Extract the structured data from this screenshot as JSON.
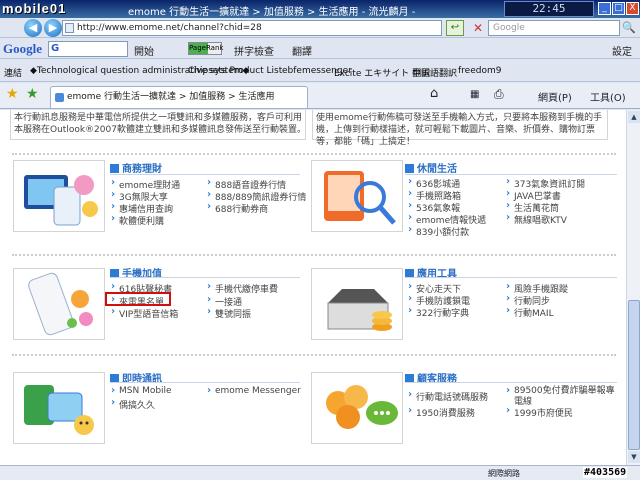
{
  "titlebar": {
    "logo": "mobile01",
    "title": "emome 行動生活一擴就達 > 加值服務 > 生活應用 - 流光麟月 -",
    "clock": "22:45",
    "minimize": "_",
    "maximize": "□",
    "close": "X"
  },
  "addressbar": {
    "back": "◀",
    "forward": "▶",
    "url": "http://www.emome.net/channel?chid=28",
    "go": "↩",
    "stop": "✕",
    "search_placeholder": "Google",
    "search_go": "🔍"
  },
  "googlebar": {
    "logo": "Google",
    "search_prefix": "G",
    "open_label": "開始",
    "pagerank_label": "PageRank",
    "spellcheck_label": "拼字檢查",
    "translate_label": "翻譯",
    "settings_label": "設定"
  },
  "linksbar": {
    "label": "連結",
    "items": [
      "◆Technological question administrative system◆",
      "Chipsets Product List",
      "ebfemessenger",
      "Excite エキサイト 翻訳",
      "中国語翻訳",
      "freedom9"
    ]
  },
  "tabbar": {
    "active_tab": "emome 行動生活一擴就達 > 加值服務 > 生活應用",
    "home": "⌂",
    "feeds": "▦",
    "print": "⎙",
    "page_label": "網頁(P)",
    "tools_label": "工具(O)"
  },
  "content": {
    "intro_left": "本行動訊息服務是中華電信所提供之一項雙訊和多媒體服務，客戶可利用本服務在Outlook®2007軟體建立雙訊和多媒體訊息發佈送至行動裝置。",
    "intro_right": "使用emome行動佈稿可發送至手機輸入方式，只要將本服務到手機的手機，上傳到行動樣描述，就可輕鬆下載圖片、音樂、折價券、購物訂票等，都能「碼」上搞定！",
    "sections": [
      {
        "title": "商務理財",
        "col1": [
          "emome理財通",
          "3G無限大享",
          "惠埔信用查詢",
          "軟體便利購"
        ],
        "col2": [
          "888語音證券行情",
          "888/889簡訊證券行情",
          "688行動券商"
        ]
      },
      {
        "title": "休閒生活",
        "col1": [
          "636影城通",
          "手機照路箱",
          "536氣象報",
          "emome情報快遞",
          "839小額付款"
        ],
        "col2": [
          "373氣象資訊訂閱",
          "JAVA巴掌書",
          "生活萬花筒",
          "無線唱歌KTV"
        ]
      },
      {
        "title": "手機加值",
        "col1": [
          "616貼聲秘書",
          "來電黑名單",
          "VIP型語音信箱"
        ],
        "col2": [
          "手機代繳停車費",
          "一接通",
          "雙號同振"
        ]
      },
      {
        "title": "應用工具",
        "col1": [
          "安心走天下",
          "手機防護鎖電",
          "322行動字典"
        ],
        "col2": [
          "風險手機跟蹤",
          "行動同步",
          "行動MAIL"
        ]
      },
      {
        "title": "即時通訊",
        "col1": [
          "MSN Mobile",
          "偶搞久久"
        ],
        "col2": [
          "emome Messenger"
        ]
      },
      {
        "title": "顧客服務",
        "col1": [
          "行動電話號碼服務",
          "1950消費服務"
        ],
        "col2": [
          "89500免付費詐騙舉報專電線",
          "1999市府便民"
        ]
      }
    ]
  },
  "statusbar": {
    "zone": "網際網路",
    "watermark": "#403569"
  },
  "colors": {
    "accent": "#2c6fc4",
    "highlight": "#d01010"
  }
}
